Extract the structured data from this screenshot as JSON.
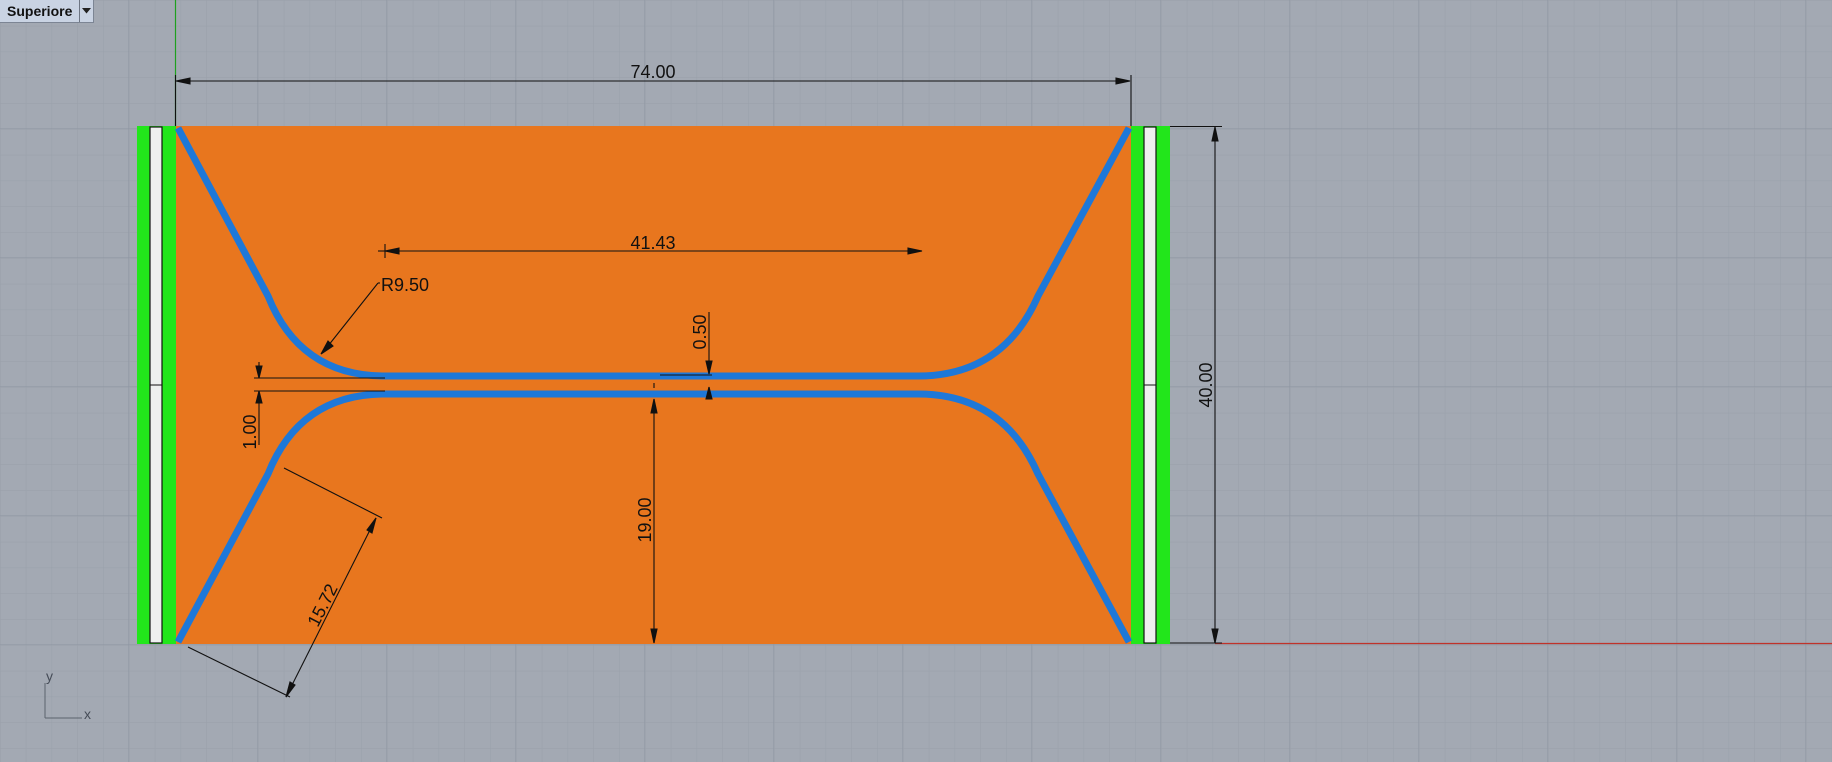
{
  "viewport": {
    "name": "Superiore",
    "menu_icon": "chevron-down-icon"
  },
  "colors": {
    "background": "#a3a9b3",
    "grid_minor": "#98a0ab",
    "grid_major": "#8c94a0",
    "fill": "#e8761e",
    "channel": "#1e78d8",
    "electrode_green": "#22e61b",
    "electrode_white": "#eef0ef",
    "y_axis": "#1fa01f",
    "x_axis": "#c0332a",
    "dimension": "#111111"
  },
  "dimensions": {
    "overall_width": "74.00",
    "overall_height": "40.00",
    "straight_length": "41.43",
    "fillet_radius": "R9.50",
    "gap": "0.50",
    "channel_width": "1.00",
    "half_height": "19.00",
    "taper_length": "15.72"
  },
  "axis_icon": {
    "x_label": "x",
    "y_label": "y"
  }
}
